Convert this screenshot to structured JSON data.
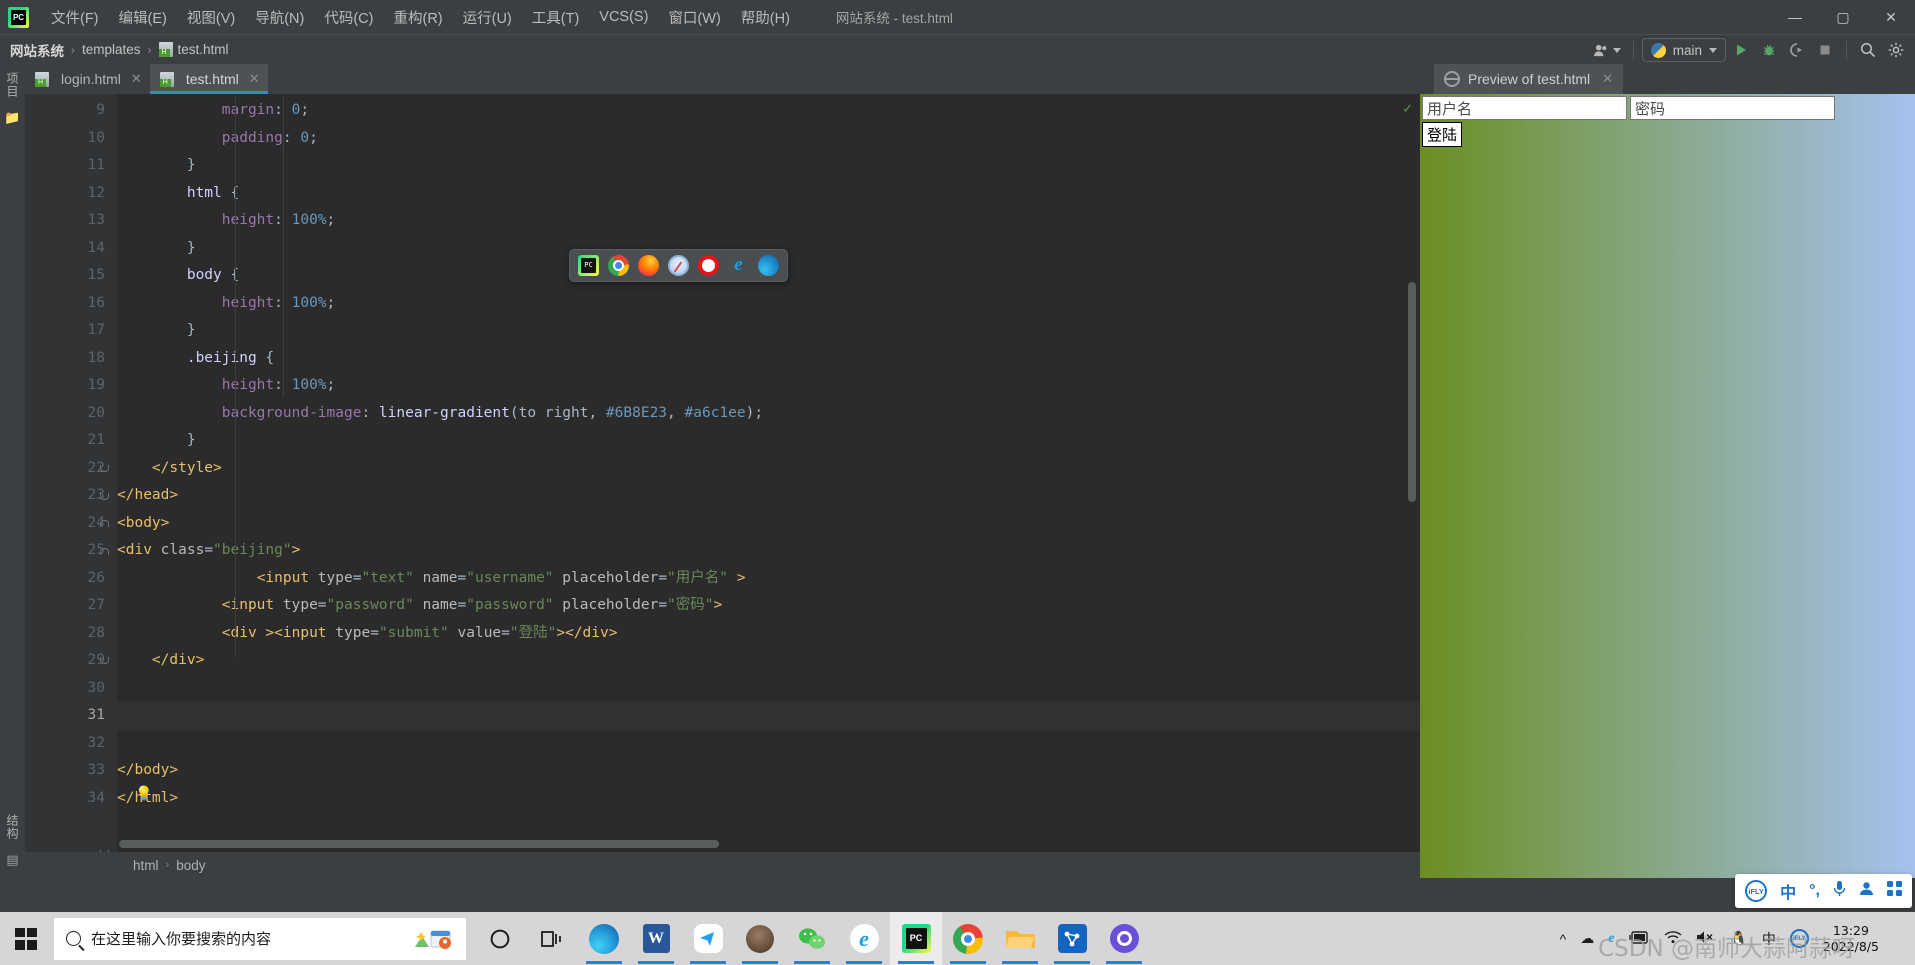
{
  "window": {
    "title": "网站系统 - test.html",
    "app_icon": "pycharm-icon",
    "controls": {
      "minimize": "—",
      "maximize": "▢",
      "close": "✕"
    }
  },
  "menubar": {
    "items": [
      {
        "label": "文件(F)"
      },
      {
        "label": "编辑(E)"
      },
      {
        "label": "视图(V)"
      },
      {
        "label": "导航(N)"
      },
      {
        "label": "代码(C)"
      },
      {
        "label": "重构(R)"
      },
      {
        "label": "运行(U)"
      },
      {
        "label": "工具(T)"
      },
      {
        "label": "VCS(S)"
      },
      {
        "label": "窗口(W)"
      },
      {
        "label": "帮助(H)"
      }
    ]
  },
  "navbar": {
    "breadcrumbs": [
      "网站系统",
      "templates",
      "test.html"
    ],
    "separator": "›",
    "run_config": "main",
    "buttons": [
      {
        "name": "account-icon",
        "glyph": "A"
      },
      {
        "name": "run-button",
        "glyph": "▶"
      },
      {
        "name": "debug-button",
        "glyph": "🐞"
      },
      {
        "name": "run-coverage-button",
        "glyph": "◗"
      },
      {
        "name": "stop-button",
        "glyph": "■"
      },
      {
        "name": "search-everywhere-button",
        "glyph": "🔍"
      },
      {
        "name": "settings-button",
        "glyph": "⚙"
      }
    ]
  },
  "left_strip": {
    "project_label": "项目",
    "structure_label": "结构"
  },
  "editor": {
    "tabs": [
      {
        "label": "login.html",
        "active": false
      },
      {
        "label": "test.html",
        "active": true
      }
    ],
    "first_line": 9,
    "current_line": 31,
    "lines": [
      {
        "n": 9,
        "html": "            <span class='tok-prop'>margin</span><span class='tok-punct'>: </span><span class='tok-num'>0</span><span class='tok-punct'>;</span>"
      },
      {
        "n": 10,
        "html": "            <span class='tok-prop'>padding</span><span class='tok-punct'>: </span><span class='tok-num'>0</span><span class='tok-punct'>;</span>"
      },
      {
        "n": 11,
        "html": "        <span class='tok-brace'>}</span>"
      },
      {
        "n": 12,
        "html": "        <span class='tok-sel'>html</span> <span class='tok-brace'>{</span>"
      },
      {
        "n": 13,
        "html": "            <span class='tok-prop'>height</span><span class='tok-punct'>: </span><span class='tok-num'>100%</span><span class='tok-punct'>;</span>"
      },
      {
        "n": 14,
        "html": "        <span class='tok-brace'>}</span>"
      },
      {
        "n": 15,
        "html": "        <span class='tok-sel'>body</span> <span class='tok-brace'>{</span>"
      },
      {
        "n": 16,
        "html": "            <span class='tok-prop'>height</span><span class='tok-punct'>: </span><span class='tok-num'>100%</span><span class='tok-punct'>;</span>"
      },
      {
        "n": 17,
        "html": "        <span class='tok-brace'>}</span>"
      },
      {
        "n": 18,
        "html": "        <span class='tok-sel'>.beijing</span> <span class='tok-brace'>{</span>"
      },
      {
        "n": 19,
        "html": "            <span class='tok-prop'>height</span><span class='tok-punct'>: </span><span class='tok-num'>100%</span><span class='tok-punct'>;</span>"
      },
      {
        "n": 20,
        "html": "            <span class='tok-prop'>background-image</span><span class='tok-punct'>: </span><span class='tok-sel'>linear-gradient</span><span class='tok-punct'>(</span><span class='tok-val'>to right</span><span class='tok-punct'>, </span><span class='tok-num'>#6B8E23</span><span class='tok-punct'>, </span><span class='tok-num'>#a6c1ee</span><span class='tok-punct'>);</span>"
      },
      {
        "n": 21,
        "html": "        <span class='tok-brace'>}</span>"
      },
      {
        "n": 22,
        "html": "    <span class='tok-tag'>&lt;/style&gt;</span>"
      },
      {
        "n": 23,
        "html": "<span class='tok-tag'>&lt;/head&gt;</span>"
      },
      {
        "n": 24,
        "html": "<span class='tok-tag'>&lt;body&gt;</span>"
      },
      {
        "n": 25,
        "html": "<span class='tok-tag'>&lt;div </span><span class='tok-attr'>class</span><span class='tok-punct'>=</span><span class='tok-str'>\"beijing\"</span><span class='tok-tag'>&gt;</span>"
      },
      {
        "n": 26,
        "html": "                <span class='tok-tag'>&lt;input </span><span class='tok-attr'>type</span><span class='tok-punct'>=</span><span class='tok-str'>\"text\"</span> <span class='tok-attr'>name</span><span class='tok-punct'>=</span><span class='tok-str'>\"username\"</span> <span class='tok-attr'>placeholder</span><span class='tok-punct'>=</span><span class='tok-str'>\"用户名\"</span> <span class='tok-tag'>&gt;</span>"
      },
      {
        "n": 27,
        "html": "            <span class='tok-tag'>&lt;input </span><span class='tok-attr'>type</span><span class='tok-punct'>=</span><span class='tok-str'>\"password\"</span> <span class='tok-attr'>name</span><span class='tok-punct'>=</span><span class='tok-str'>\"password\"</span> <span class='tok-attr'>placeholder</span><span class='tok-punct'>=</span><span class='tok-str'>\"密码\"</span><span class='tok-tag'>&gt;</span>"
      },
      {
        "n": 28,
        "html": "            <span class='tok-tag'>&lt;div &gt;&lt;input </span><span class='tok-attr'>type</span><span class='tok-punct'>=</span><span class='tok-str'>\"submit\"</span> <span class='tok-attr'>value</span><span class='tok-punct'>=</span><span class='tok-str'>\"登陆\"</span><span class='tok-tag'>&gt;&lt;/div&gt;</span>"
      },
      {
        "n": 29,
        "html": "    <span class='tok-tag'>&lt;/div&gt;</span>"
      },
      {
        "n": 30,
        "html": ""
      },
      {
        "n": 31,
        "html": ""
      },
      {
        "n": 32,
        "html": ""
      },
      {
        "n": 33,
        "html": "<span class='tok-tag'>&lt;/body&gt;</span>"
      },
      {
        "n": 34,
        "html": "<span class='tok-tag'>&lt;/html&gt;</span>"
      }
    ],
    "breadcrumb_footer": [
      "html",
      "body"
    ],
    "inspection_status": "✓"
  },
  "browser_popup": {
    "icons": [
      "pycharm-icon",
      "chrome-icon",
      "firefox-icon",
      "safari-icon",
      "opera-icon",
      "internet-explorer-icon",
      "edge-icon"
    ]
  },
  "preview": {
    "tab_label": "Preview of test.html",
    "close_glyph": "✕",
    "username_placeholder": "用户名",
    "password_placeholder": "密码",
    "submit_label": "登陆",
    "gradient_from": "#6B8E23",
    "gradient_to": "#a6c1ee"
  },
  "ime": {
    "logo": "iFLY",
    "mode": "中",
    "punctuation": "°,",
    "mic": "🎤",
    "user": "👤",
    "apps": "▦"
  },
  "taskbar": {
    "search_placeholder": "在这里输入你要搜索的内容",
    "apps": [
      {
        "name": "taskbar-edge",
        "label": "Microsoft Edge"
      },
      {
        "name": "taskbar-word",
        "label": "Word"
      },
      {
        "name": "taskbar-tim",
        "label": "TIM"
      },
      {
        "name": "taskbar-photo",
        "label": "Photos"
      },
      {
        "name": "taskbar-wechat",
        "label": "WeChat"
      },
      {
        "name": "taskbar-ie",
        "label": "Internet Explorer"
      },
      {
        "name": "taskbar-pycharm",
        "label": "PyCharm"
      },
      {
        "name": "taskbar-chrome",
        "label": "Chrome"
      },
      {
        "name": "taskbar-explorer",
        "label": "File Explorer"
      },
      {
        "name": "taskbar-navicat",
        "label": "Navicat"
      },
      {
        "name": "taskbar-360",
        "label": "360 Browser"
      }
    ],
    "tray": [
      "^",
      "☁",
      "e",
      "🔌",
      "📶",
      "🔇",
      "🐧",
      "中"
    ],
    "clock_time": "13:29",
    "clock_date": "2022/8/5",
    "watermark": "CSDN @南师大蒜阿蒜呀"
  }
}
